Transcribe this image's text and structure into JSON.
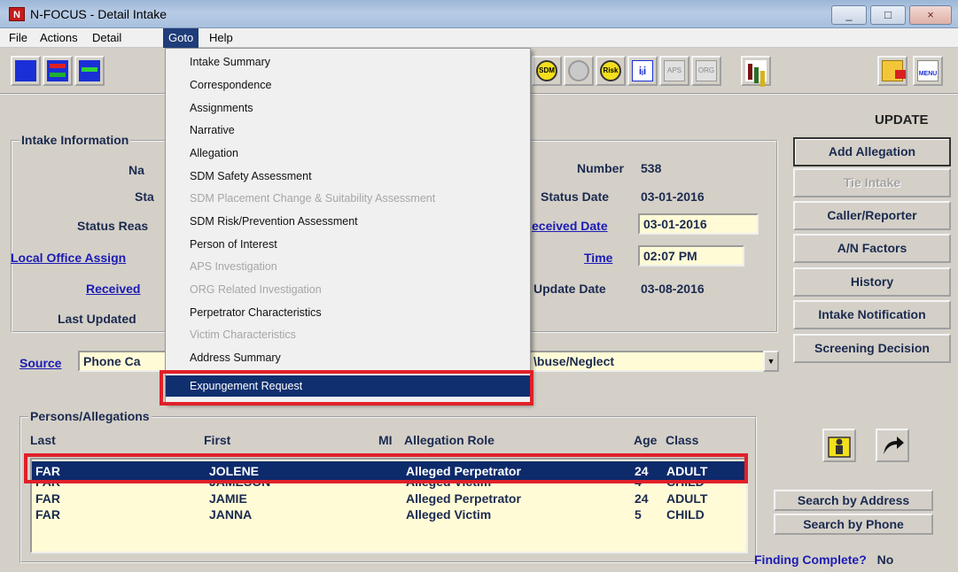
{
  "window": {
    "title": "N-FOCUS - Detail Intake",
    "app_icon": "N",
    "minimize": "_",
    "maximize": "□",
    "close": "×"
  },
  "menubar": {
    "items": [
      "File",
      "Actions",
      "Detail",
      "Goto",
      "Help"
    ],
    "active": "Goto"
  },
  "toolbar": {
    "icons": [
      "blue-doc-icon",
      "red-green-arrows-icon",
      "green-arrow-icon",
      "sdm-icon",
      "gray-circle-icon",
      "risk-icon",
      "people-icon",
      "aps-icon",
      "org-icon",
      "bar-chart-icon",
      "folder-icon",
      "menu-icon"
    ],
    "sdm_label": "SDM",
    "risk_label": "Risk",
    "aps_label": "APS",
    "org_label": "ORG",
    "menu_label": "MENU"
  },
  "mode": "UPDATE",
  "intake": {
    "group_title": "Intake Information",
    "labels": {
      "name": "Na",
      "status": "Sta",
      "status_reason": "Status Reas",
      "local_office": "Local Office Assign",
      "received": "Received",
      "last_updated": "Last Updated"
    },
    "number_label": "Number",
    "number": "538",
    "status_date_label": "Status Date",
    "status_date": "03-01-2016",
    "received_date_label": "eceived Date",
    "received_date": "03-01-2016",
    "time_label": "Time",
    "time": "02:07 PM",
    "update_date_label": "Update Date",
    "update_date": "03-08-2016"
  },
  "source": {
    "label": "Source",
    "value": "Phone Ca",
    "type_value": "\\buse/Neglect"
  },
  "right_buttons": [
    "Add Allegation",
    "Tie Intake",
    "Caller/Reporter",
    "A/N Factors",
    "History",
    "Intake Notification",
    "Screening Decision"
  ],
  "persons": {
    "group_title": "Persons/Allegations",
    "columns": [
      "Last",
      "First",
      "MI",
      "Allegation Role",
      "Age",
      "Class"
    ],
    "rows": [
      {
        "last": "FAR",
        "first": "JOLENE",
        "mi": "",
        "role": "Alleged Perpetrator",
        "age": "24",
        "class": "ADULT"
      },
      {
        "last": "FAR",
        "first": "JAMESON",
        "mi": "",
        "role": "Alleged Victim",
        "age": "4",
        "class": "CHILD"
      },
      {
        "last": "FAR",
        "first": "JAMIE",
        "mi": "",
        "role": "Alleged Perpetrator",
        "age": "24",
        "class": "ADULT"
      },
      {
        "last": "FAR",
        "first": "JANNA",
        "mi": "",
        "role": "Alleged Victim",
        "age": "5",
        "class": "CHILD"
      }
    ]
  },
  "side_buttons": {
    "search_address": "Search by Address",
    "search_phone": "Search by Phone"
  },
  "finding_complete": {
    "label": "Finding Complete?",
    "value": "No"
  },
  "goto_menu": {
    "items": [
      {
        "label": "Intake Summary",
        "enabled": true
      },
      {
        "label": "Correspondence",
        "enabled": true
      },
      {
        "label": "Assignments",
        "enabled": true
      },
      {
        "label": "Narrative",
        "enabled": true
      },
      {
        "label": "Allegation",
        "enabled": true
      },
      {
        "label": "SDM Safety Assessment",
        "enabled": true
      },
      {
        "label": "SDM Placement Change & Suitability Assessment",
        "enabled": false
      },
      {
        "label": "SDM Risk/Prevention Assessment",
        "enabled": true
      },
      {
        "label": "Person of Interest",
        "enabled": true
      },
      {
        "label": "APS Investigation",
        "enabled": false
      },
      {
        "label": "ORG Related Investigation",
        "enabled": false
      },
      {
        "label": "Perpetrator Characteristics",
        "enabled": true
      },
      {
        "label": "Victim Characteristics",
        "enabled": false
      },
      {
        "label": "Address Summary",
        "enabled": true
      },
      {
        "label": "Expungement Request",
        "enabled": true,
        "highlighted": true
      }
    ]
  },
  "colors": {
    "highlight_navy": "#0f2f6f",
    "annotation_red": "#e0202a",
    "field_yellow": "#fffbd6",
    "label_navy": "#1b2a4f"
  }
}
